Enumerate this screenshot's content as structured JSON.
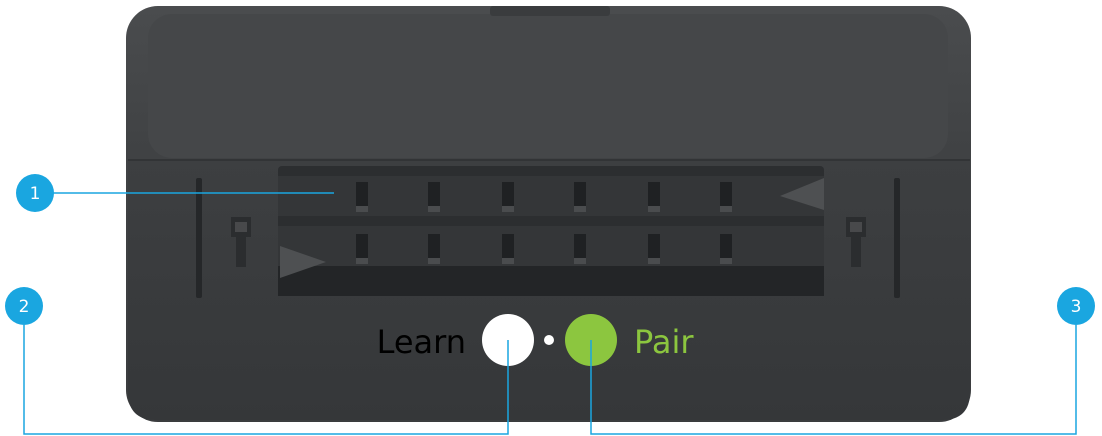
{
  "callouts": [
    {
      "number": "1"
    },
    {
      "number": "2"
    },
    {
      "number": "3"
    }
  ],
  "buttons": {
    "learn": {
      "label": "Learn",
      "color": "#ffffff"
    },
    "pair": {
      "label": "Pair",
      "color": "#8cc63f"
    }
  },
  "colors": {
    "device_body": "#3f4143",
    "device_dark": "#2f3133",
    "callout": "#1aa6e0"
  }
}
